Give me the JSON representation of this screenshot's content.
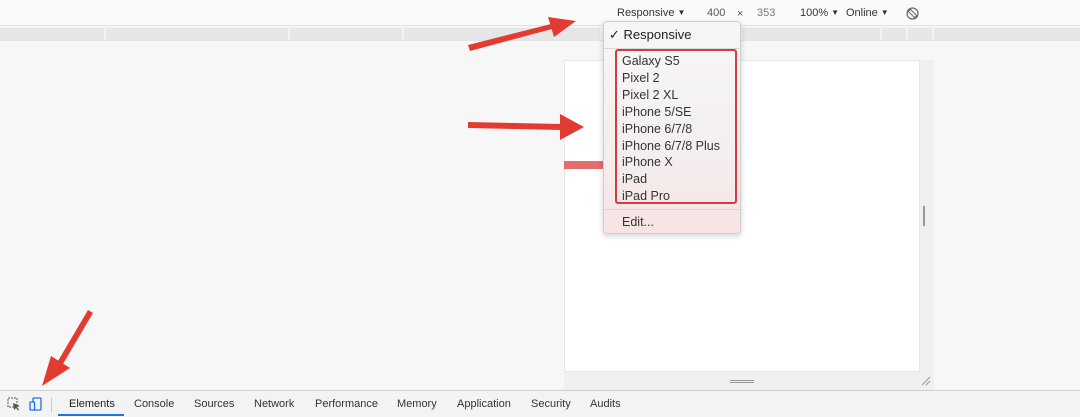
{
  "toolbar": {
    "device": "Responsive",
    "width": "400",
    "times": "×",
    "height": "353",
    "zoom": "100%",
    "network": "Online",
    "caret": "▼",
    "rotate_icon": "rotate-icon"
  },
  "dropdown": {
    "selected": "✓ Responsive",
    "devices": [
      "Galaxy S5",
      "Pixel 2",
      "Pixel 2 XL",
      "iPhone 5/SE",
      "iPhone 6/7/8",
      "iPhone 6/7/8 Plus",
      "iPhone X",
      "iPad",
      "iPad Pro"
    ],
    "edit": "Edit..."
  },
  "devtools": {
    "inspect_icon": "inspect-element-icon",
    "device_icon": "device-toolbar-icon",
    "tabs": [
      "Elements",
      "Console",
      "Sources",
      "Network",
      "Performance",
      "Memory",
      "Application",
      "Security",
      "Audits"
    ],
    "active_tab": "Elements"
  },
  "colors": {
    "annotation_red": "#e23b32",
    "highlight_border": "#d83b3b",
    "active_tab_underline": "#1a73e8"
  }
}
